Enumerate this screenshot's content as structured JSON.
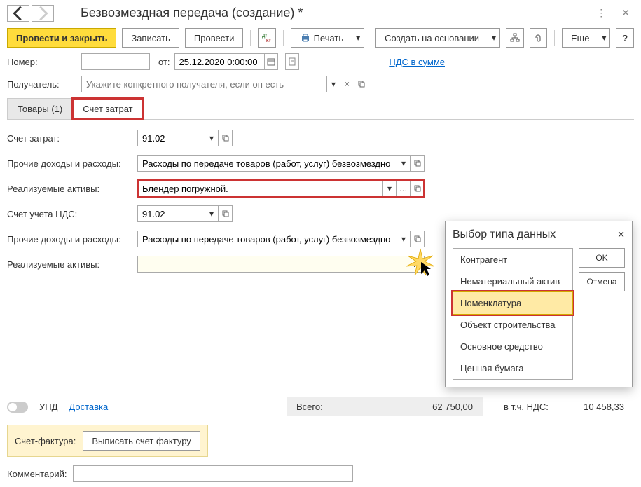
{
  "titlebar": {
    "title": "Безвозмездная передача (создание) *"
  },
  "toolbar": {
    "post_close": "Провести и закрыть",
    "save": "Записать",
    "post": "Провести",
    "print": "Печать",
    "create_based": "Создать на основании",
    "more": "Еще",
    "help": "?"
  },
  "header_form": {
    "number_label": "Номер:",
    "number_value": "",
    "from_label": "от:",
    "date_value": "25.12.2020 0:00:00",
    "vat_link": "НДС в сумме",
    "recipient_label": "Получатель:",
    "recipient_placeholder": "Укажите конкретного получателя, если он есть",
    "recipient_value": ""
  },
  "tabs": {
    "goods": "Товары (1)",
    "cost_account": "Счет затрат"
  },
  "cost_tab": {
    "cost_account_label": "Счет затрат:",
    "cost_account_value": "91.02",
    "other_income_label": "Прочие доходы и расходы:",
    "other_income_value": "Расходы по передаче товаров (работ, услуг) безвозмездно",
    "realized_assets_label": "Реализуемые активы:",
    "realized_assets_value": "Блендер погружной.",
    "vat_account_label": "Счет учета НДС:",
    "vat_account_value": "91.02",
    "other_income2_label": "Прочие доходы и расходы:",
    "other_income2_value": "Расходы по передаче товаров (работ, услуг) безвозмездно",
    "realized_assets2_label": "Реализуемые активы:",
    "realized_assets2_value": ""
  },
  "totals": {
    "upd_label": "УПД",
    "delivery_link": "Доставка",
    "total_label": "Всего:",
    "total_value": "62 750,00",
    "vat_label": "в т.ч. НДС:",
    "vat_value": "10 458,33"
  },
  "invoice": {
    "label": "Счет-фактура:",
    "button": "Выписать счет фактуру"
  },
  "comment": {
    "label": "Комментарий:",
    "value": ""
  },
  "popup": {
    "title": "Выбор типа данных",
    "items": [
      "Контрагент",
      "Нематериальный актив",
      "Номенклатура",
      "Объект строительства",
      "Основное средство",
      "Ценная бумага"
    ],
    "selected_index": 2,
    "ok": "OK",
    "cancel": "Отмена"
  }
}
